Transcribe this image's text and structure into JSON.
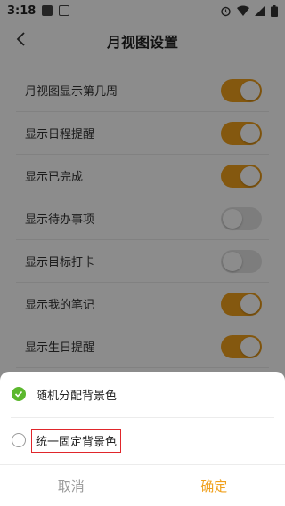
{
  "status_bar": {
    "time": "3:18"
  },
  "header": {
    "title": "月视图设置"
  },
  "settings": [
    {
      "label": "月视图显示第几周",
      "on": true
    },
    {
      "label": "显示日程提醒",
      "on": true
    },
    {
      "label": "显示已完成",
      "on": true
    },
    {
      "label": "显示待办事项",
      "on": false
    },
    {
      "label": "显示目标打卡",
      "on": false
    },
    {
      "label": "显示我的笔记",
      "on": true
    },
    {
      "label": "显示生日提醒",
      "on": true
    }
  ],
  "sheet": {
    "options": [
      {
        "label": "随机分配背景色",
        "selected": true
      },
      {
        "label": "统一固定背景色",
        "selected": false
      }
    ],
    "cancel_label": "取消",
    "ok_label": "确定"
  },
  "colors": {
    "accent": "#f0a01c",
    "check": "#5cb82e",
    "highlight_box": "#e0262b"
  }
}
